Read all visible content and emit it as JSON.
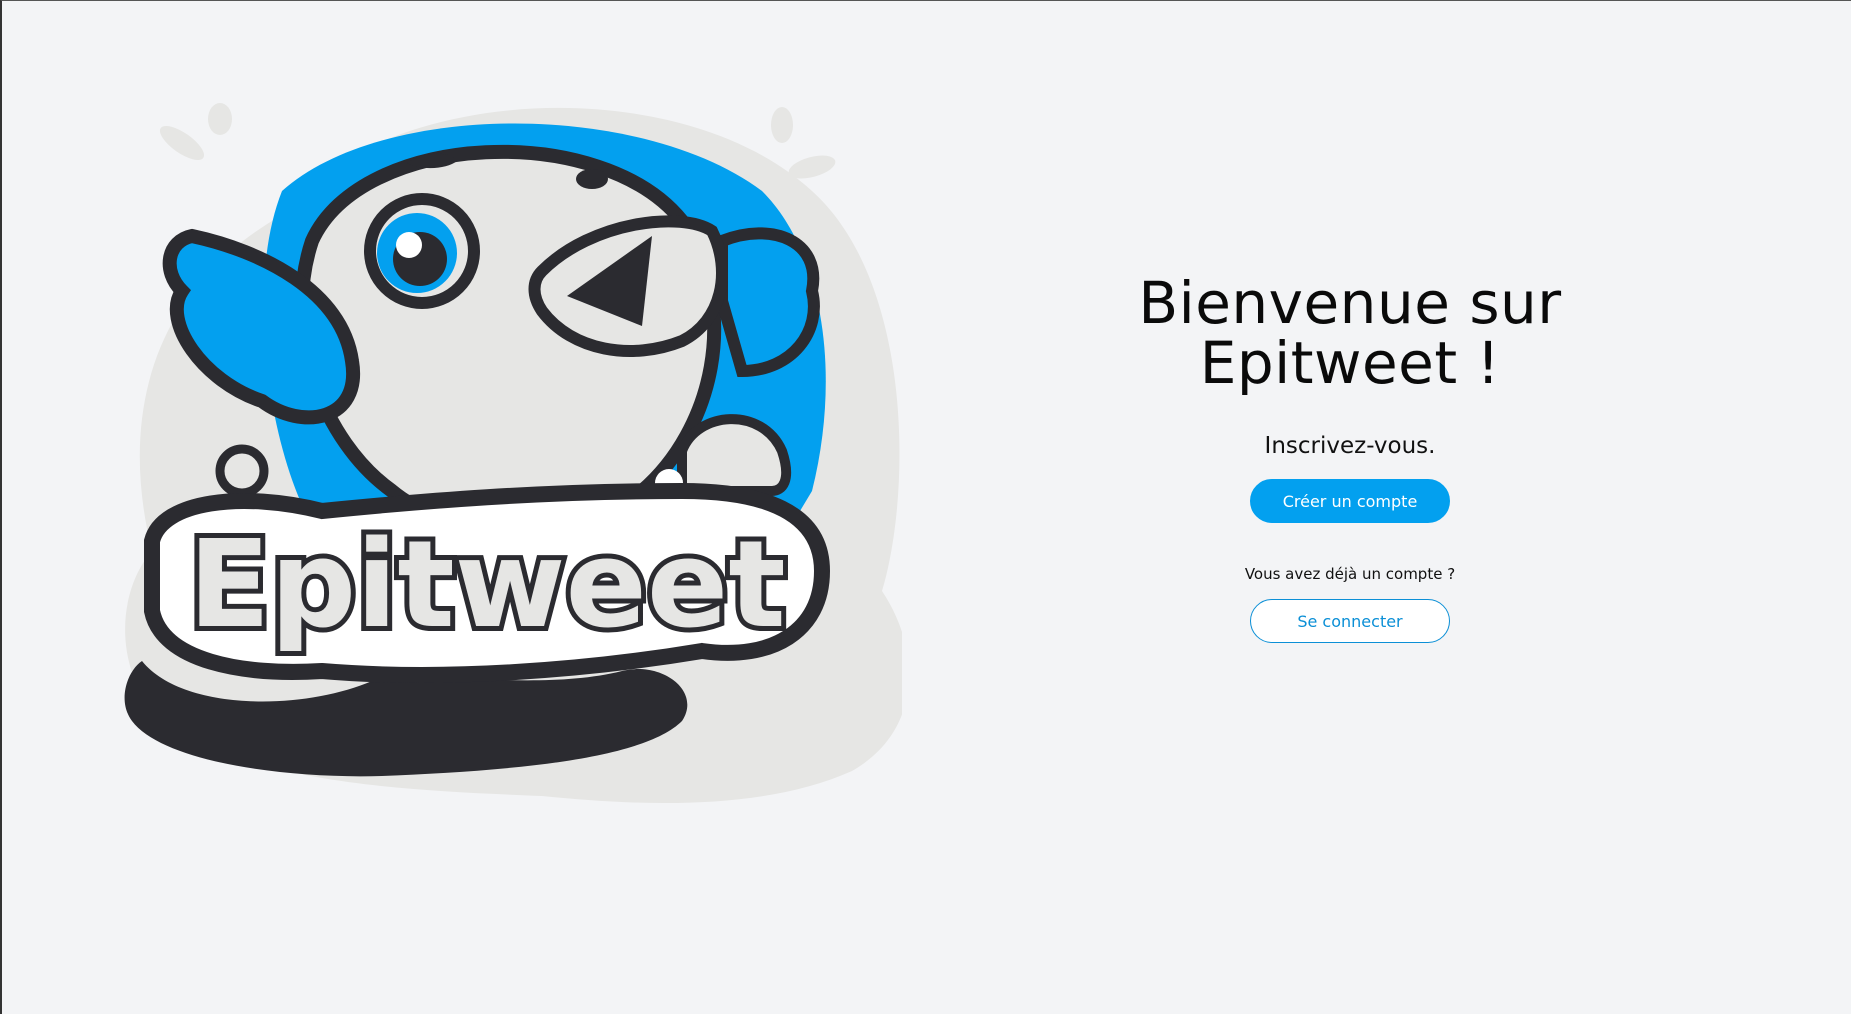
{
  "logo": {
    "text": "Epitweet",
    "colors": {
      "blue": "#03a0ef",
      "dark": "#2b2b30",
      "light": "#e6e6e4"
    }
  },
  "welcome": {
    "title_line1": "Bienvenue sur",
    "title_line2": "Epitweet !",
    "signup_prompt": "Inscrivez-vous.",
    "create_account_label": "Créer un compte",
    "already_account_prompt": "Vous avez déjà un compte ?",
    "login_label": "Se connecter"
  }
}
